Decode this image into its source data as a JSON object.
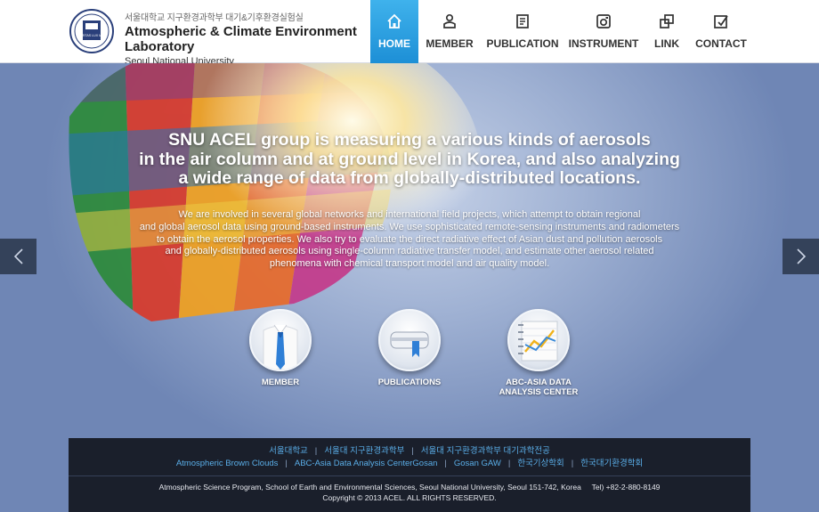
{
  "header": {
    "kr_title": "서울대학교 지구환경과학부 대기&기후환경실험실",
    "en_title_1": "Atmospheric & Climate Environment",
    "en_title_2": "Laboratory",
    "university": "Seoul National University",
    "logo_text": "VERITAS LUX MEA"
  },
  "nav": [
    {
      "label": "HOME",
      "icon": "home-icon",
      "active": true
    },
    {
      "label": "MEMBER",
      "icon": "member-icon"
    },
    {
      "label": "PUBLICATION",
      "icon": "publication-icon"
    },
    {
      "label": "INSTRUMENT",
      "icon": "instrument-icon"
    },
    {
      "label": "LINK",
      "icon": "link-icon"
    },
    {
      "label": "CONTACT",
      "icon": "contact-icon"
    }
  ],
  "hero": {
    "headline_1": "SNU ACEL group is measuring a various kinds of aerosols",
    "headline_2": "in the air column and at ground level in Korea, and also analyzing",
    "headline_3": "a wide range of data from globally-distributed locations.",
    "para_1": "We are involved in several global networks and international field projects, which attempt to obtain regional",
    "para_2": "and global aerosol data using ground-based instruments. We use sophisticated remote-sensing instruments and radiometers",
    "para_3": "to obtain the aerosol properties. We also try to evaluate the direct radiative effect of Asian dust and pollution aerosols",
    "para_4": "and globally-distributed aerosols using single-column radiative transfer model, and estimate other aerosol related",
    "para_5": "phenomena with chemical transport model and air quality model."
  },
  "quick_links": [
    {
      "label_1": "MEMBER",
      "label_2": ""
    },
    {
      "label_1": "PUBLICATIONS",
      "label_2": ""
    },
    {
      "label_1": "ABC-ASIA DATA",
      "label_2": "ANALYSIS CENTER"
    }
  ],
  "footer": {
    "links_row1": [
      "서울대학교",
      "서울대 지구환경과학부",
      "서울대 지구환경과학부 대기과학전공"
    ],
    "links_row2": [
      "Atmospheric Brown Clouds",
      "ABC-Asia Data Analysis CenterGosan",
      "Gosan GAW",
      "한국기상학회",
      "한국대기환경학회"
    ],
    "address": "Atmospheric Science Program, School of Earth and Environmental Sciences, Seoul National University, Seoul 151-742, Korea",
    "tel": "Tel) +82-2-880-8149",
    "copyright": "Copyright © 2013 ACEL. ALL RIGHTS RESERVED."
  },
  "colors": {
    "accent": "#1d8fd6",
    "footer_bg": "#1a1f2b",
    "link": "#5aaee8"
  }
}
